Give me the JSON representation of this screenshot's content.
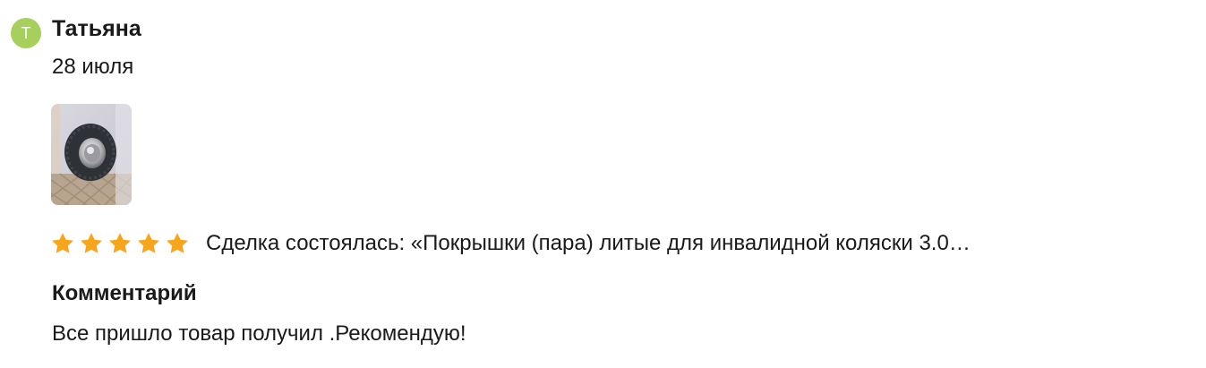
{
  "review": {
    "avatar_initial": "Т",
    "author_name": "Татьяна",
    "date": "28 июля",
    "photo": {
      "icon": "tire-photo"
    },
    "rating": {
      "value": 5,
      "max": 5,
      "star_color": "#f7a51c"
    },
    "deal_text": "Сделка состоялась: «Покрышки (пара) литые для инвалидной коляски 3.0…",
    "comment_heading": "Комментарий",
    "comment_text": "Все пришло товар получил .Рекомендую!"
  },
  "colors": {
    "avatar_bg": "#a7cf5c",
    "text": "#1a1a1a",
    "star": "#f7a51c"
  }
}
